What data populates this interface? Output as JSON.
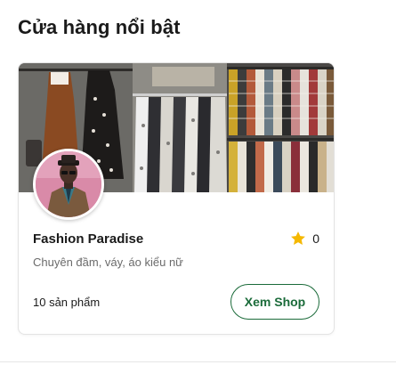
{
  "section": {
    "title": "Cửa hàng nổi bật"
  },
  "shop": {
    "name": "Fashion Paradise",
    "rating": "0",
    "description": "Chuyên đầm, váy, áo kiểu nữ",
    "product_count": "10 sản phẩm",
    "button_label": "Xem Shop",
    "cover_icon": "clothing-rack-photo",
    "avatar_icon": "shop-owner-photo"
  },
  "colors": {
    "accent": "#1b6b3a",
    "star": "#f5b800",
    "muted_text": "#6b6b6b",
    "border": "#e3e3e3"
  }
}
